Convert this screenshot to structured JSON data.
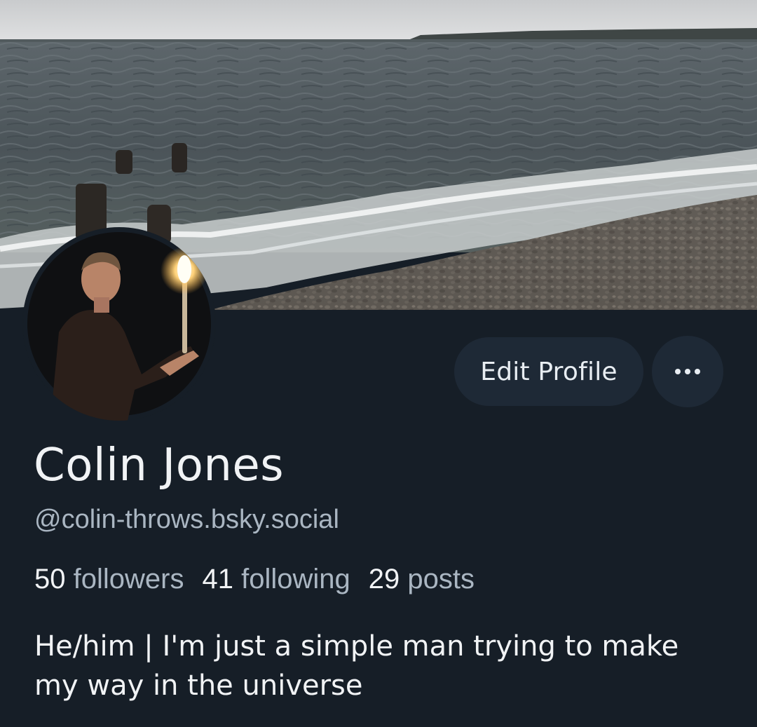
{
  "profile": {
    "display_name": "Colin Jones",
    "handle": "@colin-throws.bsky.social",
    "bio": "He/him | I'm just a simple man trying to make my way in the universe"
  },
  "stats": {
    "followers_count": "50",
    "followers_label": "followers",
    "following_count": "41",
    "following_label": "following",
    "posts_count": "29",
    "posts_label": "posts"
  },
  "actions": {
    "edit_label": "Edit Profile",
    "more_icon": "ellipsis-icon"
  },
  "banner": {
    "description_icon": "banner-image"
  },
  "colors": {
    "background": "#161e27",
    "button": "#1e2936",
    "primary_text": "#f1f3f5",
    "secondary_text": "#aab6c2"
  }
}
